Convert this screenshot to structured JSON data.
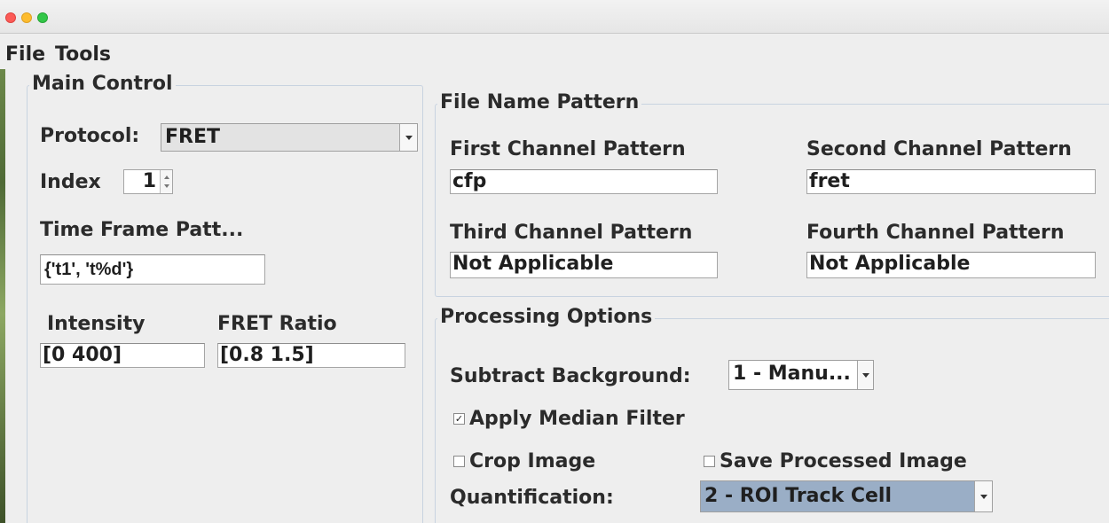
{
  "menu": {
    "file": "File",
    "tools": "Tools"
  },
  "main_control": {
    "title": "Main Control",
    "protocol_label": "Protocol:",
    "protocol_value": "FRET",
    "index_label": "Index",
    "index_value": "1",
    "time_frame_label": "Time Frame Patt...",
    "time_frame_value": "{'t1', 't%d'}",
    "intensity_label": "Intensity",
    "intensity_value": "[0 400]",
    "fret_ratio_label": "FRET Ratio",
    "fret_ratio_value": "[0.8 1.5]"
  },
  "file_name_pattern": {
    "title": "File Name Pattern",
    "first_label": "First Channel Pattern",
    "first_value": "cfp",
    "second_label": "Second Channel Pattern",
    "second_value": "fret",
    "third_label": "Third Channel Pattern",
    "third_value": "Not Applicable",
    "fourth_label": "Fourth Channel Pattern",
    "fourth_value": "Not Applicable"
  },
  "processing_options": {
    "title": "Processing Options",
    "subtract_bg_label": "Subtract Background:",
    "subtract_bg_value": "1 - Manu...",
    "median_filter_label": "Apply Median Filter",
    "median_filter_checked": true,
    "crop_label": "Crop Image",
    "crop_checked": false,
    "save_processed_label": "Save Processed Image",
    "save_processed_checked": false,
    "quantification_label": "Quantification:",
    "quantification_value": "2 - ROI Track Cell"
  },
  "colors": {
    "selected_combo": "#9aaec6",
    "frame_border": "#c8d3e0"
  },
  "icons": {
    "checkbox_checked": "check-mark-icon",
    "dropdown": "chevron-down-icon"
  }
}
